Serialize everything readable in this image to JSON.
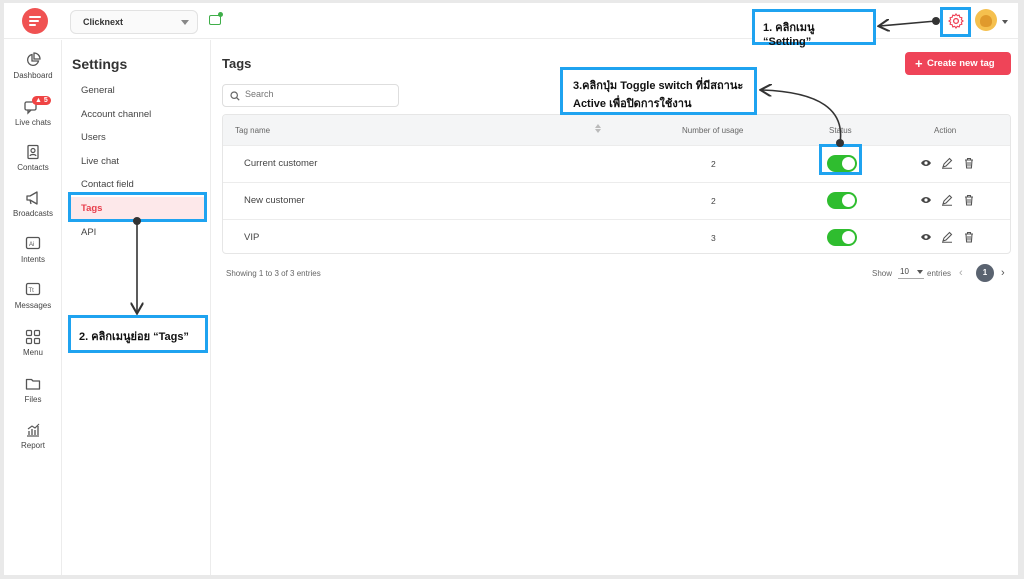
{
  "topbar": {
    "workspace": "Clicknext",
    "settings_icon": "gear-icon",
    "avatar_icon": "user-avatar-icon"
  },
  "leftnav": {
    "items": [
      {
        "label": "Dashboard",
        "icon": "pie-chart-icon"
      },
      {
        "label": "Live chats",
        "icon": "chat-bubbles-icon",
        "badge": "5"
      },
      {
        "label": "Contacts",
        "icon": "contact-card-icon"
      },
      {
        "label": "Broadcasts",
        "icon": "megaphone-icon"
      },
      {
        "label": "Intents",
        "icon": "ai-chat-icon"
      },
      {
        "label": "Messages",
        "icon": "text-message-icon"
      },
      {
        "label": "Menu",
        "icon": "grid-menu-icon"
      },
      {
        "label": "Files",
        "icon": "folder-icon"
      },
      {
        "label": "Report",
        "icon": "bar-chart-icon"
      }
    ]
  },
  "settings": {
    "title": "Settings",
    "items": [
      {
        "label": "General"
      },
      {
        "label": "Account channel"
      },
      {
        "label": "Users"
      },
      {
        "label": "Live chat"
      },
      {
        "label": "Contact field"
      },
      {
        "label": "Tags",
        "active": true
      },
      {
        "label": "API"
      }
    ]
  },
  "main": {
    "title": "Tags",
    "create_button": "Create new tag",
    "search_placeholder": "Search",
    "columns": {
      "tag_name": "Tag name",
      "usage": "Number of usage",
      "status": "Status",
      "action": "Action"
    },
    "rows": [
      {
        "name": "Current customer",
        "usage": "2",
        "active": true
      },
      {
        "name": "New customer",
        "usage": "2",
        "active": true
      },
      {
        "name": "VIP",
        "usage": "3",
        "active": true
      }
    ],
    "footer": {
      "summary": "Showing 1 to 3 of 3 entries",
      "show": "Show",
      "page_size": "10",
      "entries": "entries",
      "current_page": "1"
    }
  },
  "annotations": {
    "step1": "1. คลิกเมนู “Setting”",
    "step2": "2. คลิกเมนูย่อย “Tags”",
    "step3_line1": "3.คลิกปุ่ม Toggle switch ที่มีสถานะ",
    "step3_line2": "Active เพื่อปิดการใช้งาน"
  },
  "colors": {
    "accent": "#ef4458",
    "annotation_border": "#1fa3f0",
    "toggle_on": "#2fbd2f"
  }
}
